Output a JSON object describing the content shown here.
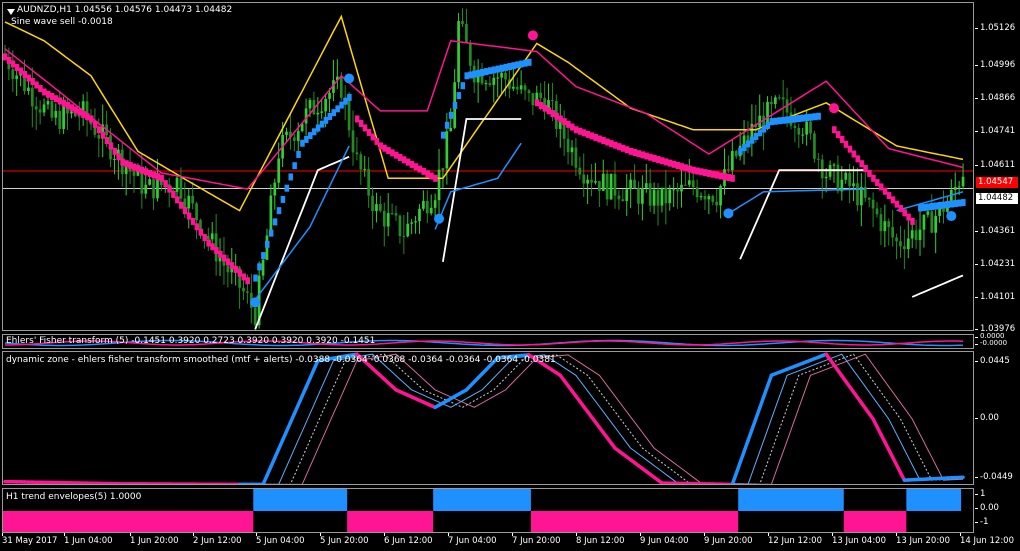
{
  "header": {
    "symbol_line": "AUDNZD,H1  1.04556 1.04576 1.04473 1.04482",
    "signal_line": "Sine wave sell -0.0018"
  },
  "colors": {
    "bull": "#32cd32",
    "bear": "#228b22",
    "up": "#1e90ff",
    "down": "#ff1493",
    "upper": "#ffd700",
    "lower": "#ffffff",
    "price_line": "#ff0000",
    "grid": "#9a9a9a"
  },
  "main_axis": {
    "ticks": [
      "1.05126",
      "1.04996",
      "1.04866",
      "1.04741",
      "1.04611",
      "1.04482",
      "1.04361",
      "1.04231",
      "1.04101",
      "1.03976"
    ],
    "current_price": "1.04482",
    "marker_price": "1.04547"
  },
  "fisher": {
    "label": "Ehlers' Fisher transform (5) -0.1451 0.3920 0.2723 0.3920 0.3920 0.3920 -0.1451",
    "axis_labels": [
      "0.0000",
      "-0.0000"
    ]
  },
  "dynamic_zone": {
    "label": "dynamic zone - ehlers fisher transform smoothed (mtf + alerts) -0.0388 -0.0364 -0.0368 -0.0364 -0.0364 -0.0364 -0.0381",
    "ticks": [
      "0.0445",
      "0.00",
      "-0.0449"
    ]
  },
  "trend_env": {
    "label": "H1 trend envelopes(5) 1.0000",
    "ticks": [
      "1",
      "0.00",
      "-1"
    ]
  },
  "x_axis": [
    "31 May 2017",
    "1 Jun 04:00",
    "1 Jun 20:00",
    "2 Jun 12:00",
    "5 Jun 04:00",
    "5 Jun 20:00",
    "6 Jun 12:00",
    "7 Jun 04:00",
    "7 Jun 20:00",
    "8 Jun 12:00",
    "9 Jun 04:00",
    "9 Jun 20:00",
    "12 Jun 12:00",
    "13 Jun 04:00",
    "13 Jun 20:00",
    "14 Jun 12:00"
  ],
  "chart_data": [
    {
      "type": "candlestick",
      "ylim": [
        1.0395,
        1.0517
      ],
      "ohlc_waypoints": [
        [
          0,
          1.0497
        ],
        [
          6,
          1.0485
        ],
        [
          12,
          1.0474
        ],
        [
          20,
          1.0476
        ],
        [
          28,
          1.0462
        ],
        [
          36,
          1.0448
        ],
        [
          44,
          1.0451
        ],
        [
          52,
          1.043
        ],
        [
          56,
          1.042
        ],
        [
          60,
          1.0412
        ],
        [
          64,
          1.0402
        ],
        [
          66,
          1.042
        ],
        [
          70,
          1.0462
        ],
        [
          76,
          1.0474
        ],
        [
          82,
          1.0483
        ],
        [
          86,
          1.0486
        ],
        [
          90,
          1.0458
        ],
        [
          95,
          1.044
        ],
        [
          102,
          1.0432
        ],
        [
          110,
          1.0448
        ],
        [
          114,
          1.047
        ],
        [
          116,
          1.0509
        ],
        [
          120,
          1.0492
        ],
        [
          128,
          1.0489
        ],
        [
          134,
          1.0481
        ],
        [
          138,
          1.0482
        ],
        [
          142,
          1.047
        ],
        [
          148,
          1.0455
        ],
        [
          154,
          1.0449
        ],
        [
          160,
          1.0447
        ],
        [
          168,
          1.0444
        ],
        [
          176,
          1.0449
        ],
        [
          182,
          1.0446
        ],
        [
          186,
          1.0458
        ],
        [
          192,
          1.0472
        ],
        [
          198,
          1.0479
        ],
        [
          204,
          1.0472
        ],
        [
          210,
          1.0454
        ],
        [
          216,
          1.0449
        ],
        [
          222,
          1.044
        ],
        [
          228,
          1.0428
        ],
        [
          236,
          1.0435
        ],
        [
          242,
          1.0445
        ],
        [
          245,
          1.0455
        ]
      ],
      "upper_band_waypoints": [
        [
          0,
          1.051
        ],
        [
          10,
          1.0503
        ],
        [
          22,
          1.049
        ],
        [
          34,
          1.0462
        ],
        [
          48,
          1.045
        ],
        [
          60,
          1.044
        ],
        [
          86,
          1.0512
        ],
        [
          98,
          1.0452
        ],
        [
          112,
          1.0452
        ],
        [
          136,
          1.0502
        ],
        [
          144,
          1.0495
        ],
        [
          160,
          1.0478
        ],
        [
          176,
          1.047
        ],
        [
          192,
          1.047
        ],
        [
          210,
          1.048
        ],
        [
          228,
          1.0464
        ],
        [
          245,
          1.0459
        ]
      ],
      "pink_band_waypoints": [
        [
          0,
          1.05
        ],
        [
          14,
          1.0484
        ],
        [
          26,
          1.047
        ],
        [
          40,
          1.0454
        ],
        [
          62,
          1.0448
        ],
        [
          86,
          1.049
        ],
        [
          96,
          1.0477
        ],
        [
          108,
          1.0477
        ],
        [
          114,
          1.0503
        ],
        [
          136,
          1.0499
        ],
        [
          146,
          1.0486
        ],
        [
          164,
          1.0476
        ],
        [
          180,
          1.0461
        ],
        [
          210,
          1.0488
        ],
        [
          226,
          1.0463
        ],
        [
          245,
          1.0456
        ]
      ],
      "lower_band_waypoints": [
        [
          64,
          1.0396
        ],
        [
          80,
          1.0455
        ],
        [
          88,
          1.046
        ],
        [
          null,
          null
        ],
        [
          112,
          1.0421
        ],
        [
          118,
          1.0474
        ],
        [
          132,
          1.0474
        ],
        [
          null,
          null
        ],
        [
          188,
          1.0422
        ],
        [
          198,
          1.0455
        ],
        [
          220,
          1.0455
        ],
        [
          null,
          null
        ],
        [
          232,
          1.0408
        ],
        [
          245,
          1.0416
        ]
      ],
      "blue_band_waypoints": [
        [
          64,
          1.0407
        ],
        [
          78,
          1.0434
        ],
        [
          88,
          1.0464
        ],
        [
          null,
          null
        ],
        [
          110,
          1.0433
        ],
        [
          114,
          1.0447
        ],
        [
          126,
          1.0452
        ],
        [
          132,
          1.0465
        ],
        [
          null,
          null
        ],
        [
          184,
          1.0438
        ],
        [
          194,
          1.0447
        ],
        [
          220,
          1.0448
        ],
        [
          null,
          null
        ],
        [
          228,
          1.044
        ],
        [
          245,
          1.0447
        ]
      ],
      "up_markers": [
        [
          64,
          1.0406
        ],
        [
          88,
          1.0489
        ],
        [
          111,
          1.0437
        ],
        [
          185,
          1.0439
        ],
        [
          242,
          1.0438
        ]
      ],
      "down_markers": [
        [
          135,
          1.0505
        ],
        [
          212,
          1.0478
        ]
      ]
    },
    {
      "type": "line",
      "ylim": [
        -0.046,
        0.046
      ],
      "series_waypoints": [
        [
          0,
          -0.043
        ],
        [
          30,
          -0.0445
        ],
        [
          60,
          -0.0449
        ],
        [
          66,
          -0.0449
        ],
        [
          80,
          0.04
        ],
        [
          90,
          0.0445
        ],
        [
          100,
          0.02
        ],
        [
          110,
          0.008
        ],
        [
          118,
          0.02
        ],
        [
          126,
          0.042
        ],
        [
          134,
          0.044
        ],
        [
          142,
          0.03
        ],
        [
          156,
          -0.02
        ],
        [
          168,
          -0.044
        ],
        [
          186,
          -0.0449
        ],
        [
          196,
          0.03
        ],
        [
          210,
          0.0445
        ],
        [
          222,
          0.0
        ],
        [
          230,
          -0.042
        ],
        [
          245,
          -0.04
        ]
      ]
    },
    {
      "type": "bar",
      "ylim": [
        -1.2,
        1.2
      ],
      "segments": [
        [
          0,
          64,
          -1
        ],
        [
          64,
          88,
          1
        ],
        [
          88,
          110,
          -1
        ],
        [
          110,
          135,
          1
        ],
        [
          135,
          188,
          -1
        ],
        [
          188,
          215,
          1
        ],
        [
          215,
          231,
          -1
        ],
        [
          231,
          245,
          1
        ]
      ]
    }
  ]
}
